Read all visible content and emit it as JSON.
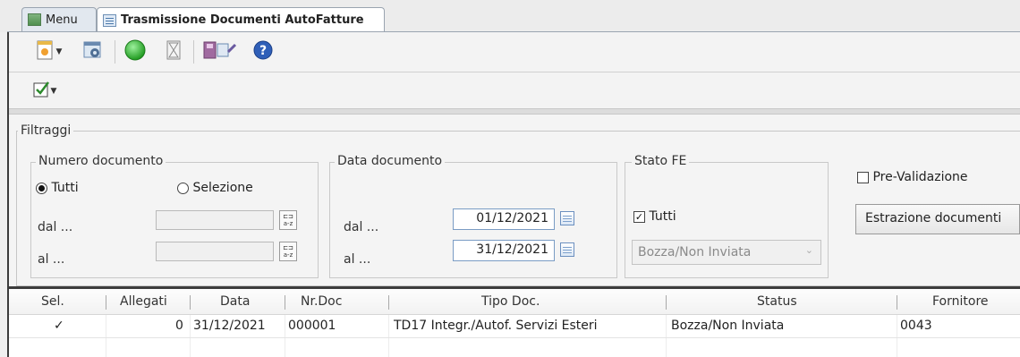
{
  "tabs": [
    {
      "label": "Menu",
      "icon": "menu-icon",
      "active": false
    },
    {
      "label": "Trasmissione Documenti AutoFatture",
      "icon": "document-list-icon",
      "active": true
    }
  ],
  "toolbar": {
    "buttons": [
      "new-dropdown-icon",
      "settings-icon",
      "green-circle-icon",
      "hourglass-icon",
      "export-icon",
      "help-icon"
    ],
    "check_menu_icon": "checkbox-checked-icon"
  },
  "filter": {
    "title": "Filtraggi",
    "numero": {
      "title": "Numero documento",
      "tutti_label": "Tutti",
      "selezione_label": "Selezione",
      "selected": "Tutti",
      "dal_label": "dal ...",
      "al_label": "al ...",
      "dal_value": "",
      "al_value": "",
      "az_label": "a-z"
    },
    "data": {
      "title": "Data documento",
      "dal_label": "dal ...",
      "al_label": "al ...",
      "dal_value": "01/12/2021",
      "al_value": "31/12/2021"
    },
    "stato": {
      "title": "Stato FE",
      "tutti_label": "Tutti",
      "tutti_checked": true,
      "combo_value": "Bozza/Non Inviata"
    },
    "prevalidazione_label": "Pre-Validazione",
    "prevalidazione_checked": false,
    "estrazione_button": "Estrazione documenti"
  },
  "grid": {
    "columns": [
      "Sel.",
      "Allegati",
      "Data",
      "Nr.Doc",
      "Tipo Doc.",
      "Status",
      "Fornitore"
    ],
    "rows": [
      {
        "sel": "✓",
        "allegati": "0",
        "data": "31/12/2021",
        "nrdoc": "000001",
        "tipo": "TD17 Integr./Autof. Servizi Esteri",
        "status": "Bozza/Non Inviata",
        "fornitore": "0043"
      }
    ]
  },
  "colors": {
    "accent_green": "#2bb52b",
    "help_blue": "#2f5fb8",
    "check_green": "#2c8a2c"
  }
}
